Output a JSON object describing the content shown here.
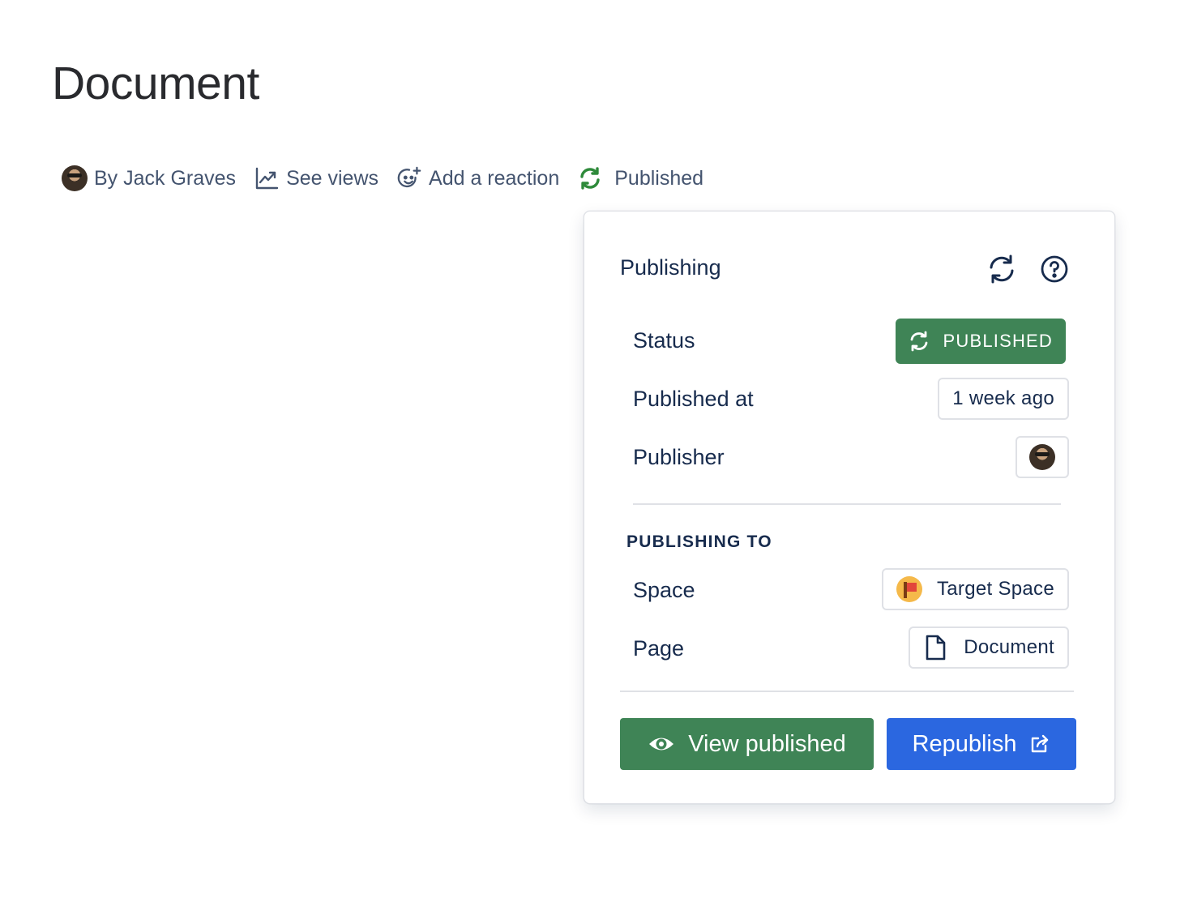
{
  "page": {
    "title": "Document"
  },
  "byline": {
    "author": "By Jack Graves",
    "views": "See views",
    "reaction": "Add a reaction",
    "status": "Published"
  },
  "popup": {
    "title": "Publishing",
    "rows": {
      "status_label": "Status",
      "status_value": "PUBLISHED",
      "published_at_label": "Published at",
      "published_at_value": "1 week ago",
      "publisher_label": "Publisher"
    },
    "section_heading": "PUBLISHING TO",
    "target": {
      "space_label": "Space",
      "space_value": "Target Space",
      "page_label": "Page",
      "page_value": "Document"
    },
    "buttons": {
      "view_published": "View published",
      "republish": "Republish"
    }
  },
  "colors": {
    "green": "#3f8456",
    "blue": "#2b67e0",
    "text": "#172b4d",
    "muted": "#44546f"
  },
  "icons": [
    "refresh-icon",
    "help-icon",
    "trend-chart-icon",
    "add-reaction-icon",
    "eye-icon",
    "share-out-icon",
    "document-icon"
  ]
}
